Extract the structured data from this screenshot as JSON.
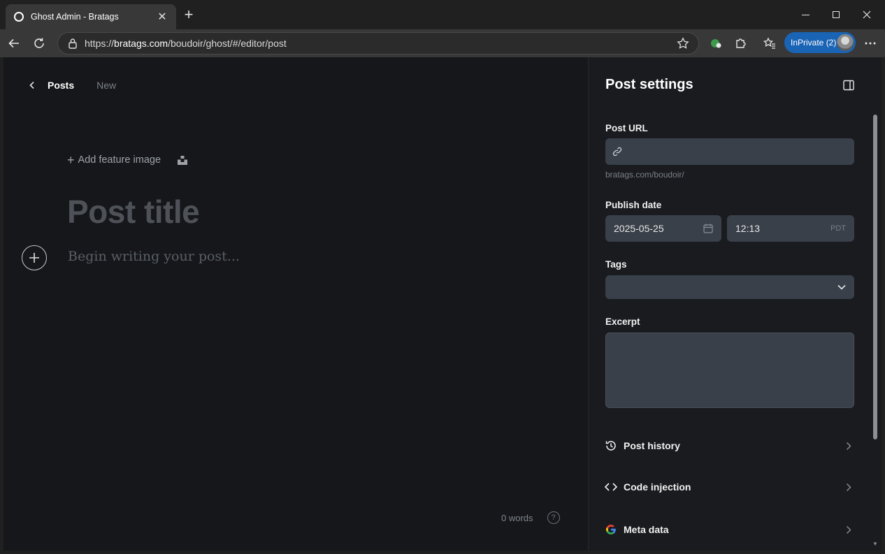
{
  "browser": {
    "tab_title": "Ghost Admin - Bratags",
    "url_prefix": "https://",
    "url_host": "bratags.com",
    "url_path": "/boudoir/ghost/#/editor/post",
    "inprivate_label": "InPrivate (2)"
  },
  "editor": {
    "breadcrumb_posts": "Posts",
    "post_status": "New",
    "add_feature_image": "Add feature image",
    "title_placeholder": "Post title",
    "body_placeholder": "Begin writing your post...",
    "word_count": "0 words",
    "help_symbol": "?"
  },
  "settings": {
    "heading": "Post settings",
    "post_url_label": "Post URL",
    "post_url_value": "",
    "post_url_hint": "bratags.com/boudoir/",
    "publish_date_label": "Publish date",
    "publish_date": "2025-05-25",
    "publish_time": "12:13",
    "timezone": "PDT",
    "tags_label": "Tags",
    "excerpt_label": "Excerpt",
    "excerpt_value": "",
    "rows": [
      {
        "label": "Post history",
        "icon": "history-icon"
      },
      {
        "label": "Code injection",
        "icon": "code-icon"
      },
      {
        "label": "Meta data",
        "icon": "google-icon"
      }
    ]
  },
  "colors": {
    "accent": "#1a64b5",
    "editor_bg": "#15171a",
    "sidebar_bg": "#191b1f",
    "field_bg": "#394049"
  }
}
